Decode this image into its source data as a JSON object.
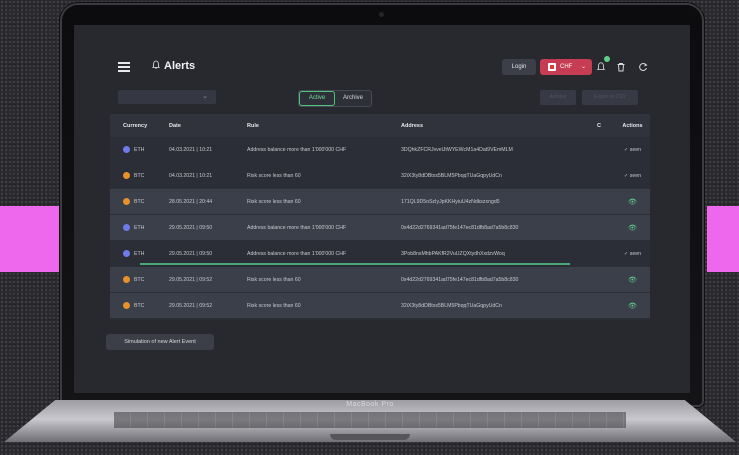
{
  "device": {
    "brand": "MacBook Pro"
  },
  "app": {
    "title": "Alerts",
    "header": {
      "login_label": "Login",
      "currency": "CHF",
      "currency_caret": "⌄"
    },
    "toolbar": {
      "tab_active": "Active",
      "tab_archive": "Archive",
      "archive_label": "Archive",
      "export_label": "Export to CSV"
    },
    "table": {
      "columns": [
        "Currency",
        "Date",
        "Rule",
        "Address",
        "C",
        "Actions"
      ],
      "rows": [
        {
          "currency": "ETH",
          "date": "04.03.2021 | 10:21",
          "rule": "Address balance more than 1'000'000 CHF",
          "address": "3DQhkZFCRJvvelJtWYEWcM1a4Dat9VEmMLM",
          "action": "seen"
        },
        {
          "currency": "BTC",
          "date": "04.03.2021 | 10:21",
          "rule": "Risk score less than 60",
          "address": "32iX3ty8dDBtxs5BLM5PbqqTUaGqpyUdCn",
          "action": "seen"
        },
        {
          "currency": "BTC",
          "date": "28.05.2021 | 20:44",
          "rule": "Risk score less than 60",
          "address": "171QL9D5oSzIyJpKKHyiuU4zNdkszxngd5",
          "action": "view"
        },
        {
          "currency": "ETH",
          "date": "29.05.2021 | 09:50",
          "rule": "Address balance more than 1'000'000 CHF",
          "address": "0x4d22d2769341ad75fe147ec81dfb8ad7a5b8c830",
          "action": "view"
        },
        {
          "currency": "ETH",
          "date": "29.05.2021 | 09:50",
          "rule": "Address balance more than 1'000'000 CHF",
          "address": "3Pob8nsMhbPAKfR2VuUZQXtydhXxdzvWoq",
          "action": "seen"
        },
        {
          "currency": "BTC",
          "date": "29.05.2021 | 09:52",
          "rule": "Risk score less than 60",
          "address": "0x4d22d2769341ad75fe147ec81dfb8ad7a5b8c830",
          "action": "view"
        },
        {
          "currency": "BTC",
          "date": "29.05.2021 | 09:52",
          "rule": "Risk score less than 60",
          "address": "32iX3ty8dDBtxs5BLM5PbqqTUaGqpyUdCn",
          "action": "view"
        }
      ]
    },
    "simulate_label": "Simulation of new Alert Event",
    "colors": {
      "accent": "#5fd08c",
      "chf_button": "#c63c52",
      "eth": "#6f7ce8",
      "btc": "#e8902a"
    }
  }
}
